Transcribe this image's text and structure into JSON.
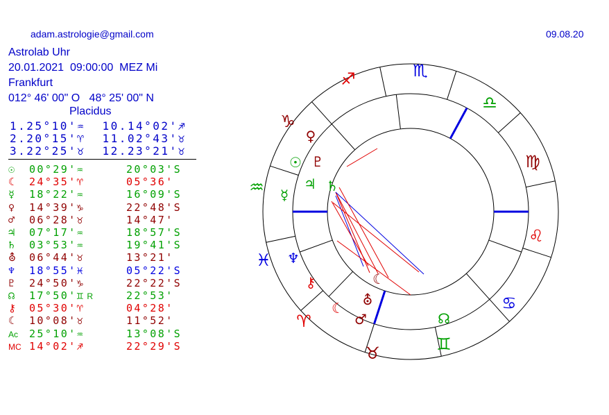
{
  "header": {
    "email": "adam.astrologie@gmail.com",
    "date": "09.08.20",
    "lines": [
      "Astrolab Uhr",
      "20.01.2021  09:00:00  MEZ Mi",
      "Frankfurt",
      "012° 46' 00\" O   48° 25' 00\" N"
    ],
    "house_system": "Placidus"
  },
  "cusps": [
    {
      "text": "1.25°10'♒  10.14°02'♐"
    },
    {
      "text": "2.20°15'♈  11.02°43'♉"
    },
    {
      "text": "3.22°25'♉  12.23°21'♉"
    }
  ],
  "planets": [
    {
      "name": "Sun",
      "symbol": "☉",
      "lon": "00°29'♒",
      "lat": "20°03'S",
      "color": "#00a000"
    },
    {
      "name": "Moon",
      "symbol": "☾",
      "lon": "24°35'♈",
      "lat": "05°36'",
      "color": "#e00000"
    },
    {
      "name": "Mercury",
      "symbol": "☿",
      "lon": "18°22'♒",
      "lat": "16°09'S",
      "color": "#00a000"
    },
    {
      "name": "Venus",
      "symbol": "♀",
      "lon": "14°39'♑",
      "lat": "22°48'S",
      "color": "#900000"
    },
    {
      "name": "Mars",
      "symbol": "♂",
      "lon": "06°28'♉",
      "lat": "14°47'",
      "color": "#900000"
    },
    {
      "name": "Jupiter",
      "symbol": "♃",
      "lon": "07°17'♒",
      "lat": "18°57'S",
      "color": "#00a000"
    },
    {
      "name": "Saturn",
      "symbol": "♄",
      "lon": "03°53'♒",
      "lat": "19°41'S",
      "color": "#00a000"
    },
    {
      "name": "Uranus",
      "symbol": "⛢",
      "lon": "06°44'♉",
      "lat": "13°21'",
      "color": "#900000"
    },
    {
      "name": "Neptune",
      "symbol": "♆",
      "lon": "18°55'♓",
      "lat": "05°22'S",
      "color": "#0000e0"
    },
    {
      "name": "Pluto",
      "symbol": "♇",
      "lon": "24°50'♑",
      "lat": "22°22'S",
      "color": "#900000"
    },
    {
      "name": "Node",
      "symbol": "☊",
      "lon": "17°50'♊",
      "lat": "22°53'",
      "color": "#00a000",
      "flag": "R"
    },
    {
      "name": "Chiron",
      "symbol": "⚷",
      "lon": "05°30'♈",
      "lat": "04°28'",
      "color": "#e00000"
    },
    {
      "name": "Lilith",
      "symbol": "☾",
      "lon": "10°08'♉",
      "lat": "11°52'",
      "color": "#900000"
    },
    {
      "name": "Ascendant",
      "symbol": "Ac",
      "lon": "25°10'♒",
      "lat": "13°08'S",
      "color": "#00a000"
    },
    {
      "name": "Midheaven",
      "symbol": "MC",
      "lon": "14°02'♐",
      "lat": "22°29'S",
      "color": "#e00000"
    }
  ],
  "wheel": {
    "signs": [
      {
        "glyph": "♈",
        "color": "#e00000"
      },
      {
        "glyph": "♉",
        "color": "#900000"
      },
      {
        "glyph": "♊",
        "color": "#00a000"
      },
      {
        "glyph": "♋",
        "color": "#0000e0"
      },
      {
        "glyph": "♌",
        "color": "#e00000"
      },
      {
        "glyph": "♍",
        "color": "#900000"
      },
      {
        "glyph": "♎",
        "color": "#00a000"
      },
      {
        "glyph": "♏",
        "color": "#0000e0"
      },
      {
        "glyph": "♐",
        "color": "#e00000"
      },
      {
        "glyph": "♑",
        "color": "#900000"
      },
      {
        "glyph": "♒",
        "color": "#00a000"
      },
      {
        "glyph": "♓",
        "color": "#0000e0"
      }
    ],
    "planet_glyphs": [
      {
        "glyph": "♀",
        "color": "#900000"
      },
      {
        "glyph": "♇",
        "color": "#900000"
      },
      {
        "glyph": "☉",
        "color": "#00a000"
      },
      {
        "glyph": "♃",
        "color": "#00a000"
      },
      {
        "glyph": "♄",
        "color": "#00a000"
      },
      {
        "glyph": "☿",
        "color": "#00a000"
      },
      {
        "glyph": "♆",
        "color": "#0000e0"
      },
      {
        "glyph": "⚷",
        "color": "#e00000"
      },
      {
        "glyph": "☾",
        "color": "#e00000"
      },
      {
        "glyph": "☾",
        "color": "#900000"
      },
      {
        "glyph": "⛢",
        "color": "#900000"
      },
      {
        "glyph": "♂",
        "color": "#900000"
      },
      {
        "glyph": "☊",
        "color": "#00a000"
      }
    ]
  }
}
